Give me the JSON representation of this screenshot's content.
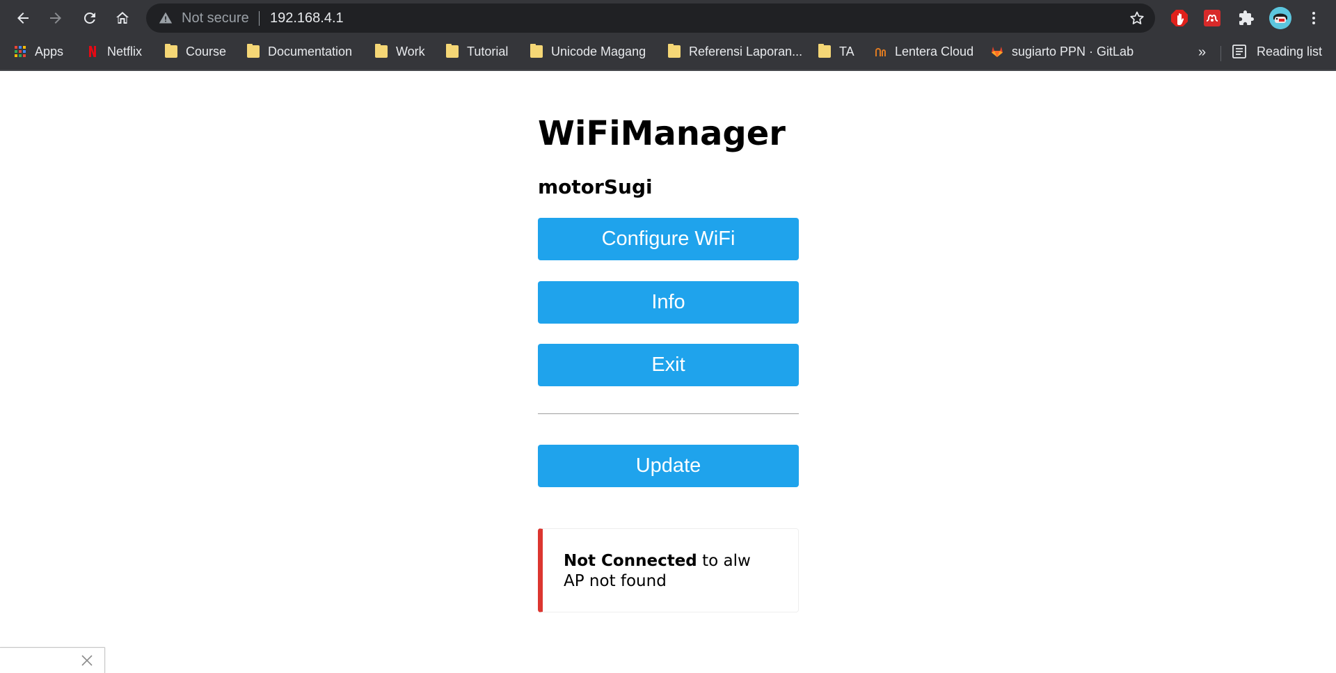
{
  "browser": {
    "security_label": "Not secure",
    "url": "192.168.4.1",
    "bookmarks": [
      {
        "label": "Apps",
        "icon": "apps-grid-icon"
      },
      {
        "label": "Netflix",
        "icon": "netflix-icon"
      },
      {
        "label": "Course",
        "icon": "folder-icon"
      },
      {
        "label": "Documentation",
        "icon": "folder-icon"
      },
      {
        "label": "Work",
        "icon": "folder-icon"
      },
      {
        "label": "Tutorial",
        "icon": "folder-icon"
      },
      {
        "label": "Unicode Magang",
        "icon": "folder-icon"
      },
      {
        "label": "Referensi Laporan...",
        "icon": "folder-icon"
      },
      {
        "label": "TA",
        "icon": "folder-icon"
      },
      {
        "label": "Lentera Cloud",
        "icon": "lentera-icon"
      },
      {
        "label": "sugiarto PPN · GitLab",
        "icon": "gitlab-icon"
      }
    ],
    "more_bookmarks": "»",
    "reading_list": "Reading list",
    "colors": {
      "chrome_bg": "#35363a",
      "omnibox_bg": "#202124",
      "folder": "#f5d776"
    }
  },
  "page": {
    "title": "WiFiManager",
    "device_name": "motorSugi",
    "buttons": {
      "configure": "Configure WiFi",
      "info": "Info",
      "exit": "Exit",
      "update": "Update"
    },
    "status": {
      "bold": "Not Connected",
      "rest": " to alw",
      "detail": "AP not found"
    },
    "colors": {
      "button": "#1fa3ec",
      "status_accent": "#dc3630"
    }
  }
}
